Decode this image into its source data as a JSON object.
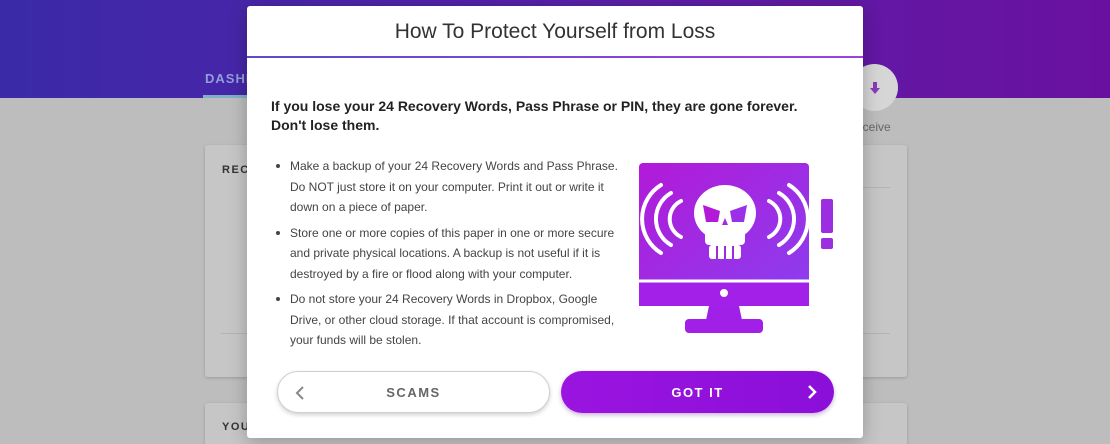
{
  "background": {
    "dashboard_tab": "DASHB",
    "receive_label": "eceive",
    "card1_title": "RECE",
    "card2_title": "YOU"
  },
  "modal": {
    "title": "How To Protect Yourself from Loss",
    "warning": "If you lose your 24 Recovery Words, Pass Phrase or PIN, they are gone forever. Don't lose them.",
    "bullets": [
      "Make a backup of your 24 Recovery Words and Pass Phrase. Do NOT just store it on your computer. Print it out or write it down on a piece of paper.",
      "Store one or more copies of this paper in one or more secure and private physical locations. A backup is not useful if it is destroyed by a fire or flood along with your computer.",
      "Do not store your 24 Recovery Words in Dropbox, Google Drive, or other cloud storage. If that account is compromised, your funds will be stolen."
    ],
    "illustration_icon": "hacked-computer-icon",
    "buttons": {
      "scams": "SCAMS",
      "got_it": "GOT IT"
    }
  },
  "colors": {
    "accent": "#9b14e0",
    "header_start": "#3a2aa8",
    "header_end": "#6a10a0"
  }
}
